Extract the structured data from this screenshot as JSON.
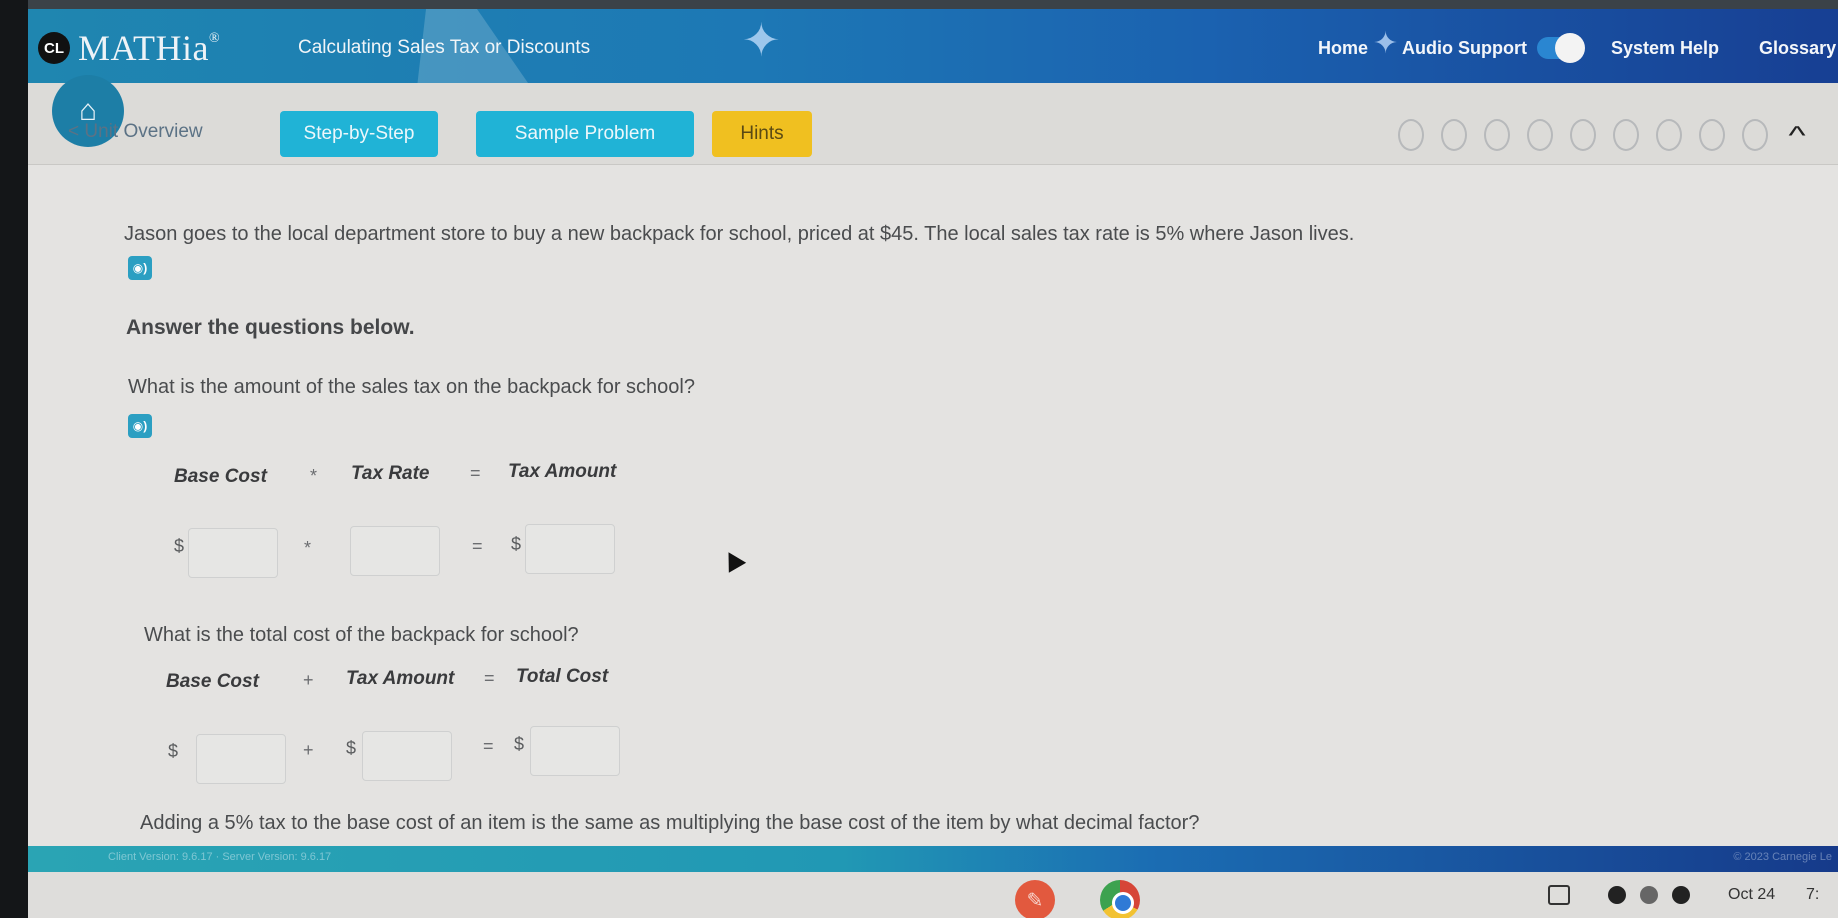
{
  "header": {
    "logo_badge": "CL",
    "logo_text": "MATHia",
    "logo_mark": "®",
    "lesson_title": "Calculating Sales Tax or Discounts",
    "nav": {
      "home": "Home",
      "audio_support": "Audio Support",
      "audio_support_enabled": true,
      "system_help": "System Help",
      "glossary": "Glossary"
    }
  },
  "toolbar": {
    "unit_overview": "< Unit Overview",
    "tabs": [
      {
        "label": "Step-by-Step",
        "color": "#20b3d6"
      },
      {
        "label": "Sample Problem",
        "color": "#20b3d6"
      },
      {
        "label": "Hints",
        "color": "#f0c020"
      }
    ],
    "progress": {
      "completed": 0,
      "total": 9
    },
    "collapse_icon": "chevron-up-icon"
  },
  "problem": {
    "intro": "Jason goes to the local department store to buy a new backpack for school, priced at $45. The local sales tax rate is 5% where Jason lives.",
    "instructions": "Answer the questions below.",
    "q1": {
      "text": "What is the amount of the sales tax on the backpack for school?",
      "labels": [
        "Base Cost",
        "Tax Rate",
        "Tax Amount"
      ],
      "operators": [
        "*",
        "="
      ],
      "prefixes": [
        "$",
        "",
        "$"
      ],
      "values": [
        "",
        "",
        ""
      ]
    },
    "q2": {
      "text": "What is the total cost of the backpack for school?",
      "labels": [
        "Base Cost",
        "Tax Amount",
        "Total Cost"
      ],
      "operators": [
        "+",
        "="
      ],
      "prefixes": [
        "$",
        "$",
        "$"
      ],
      "values": [
        "",
        "",
        ""
      ]
    },
    "q3": {
      "text": "Adding a 5% tax to the base cost of an item is the same as multiplying the base cost of the item by what decimal factor?"
    }
  },
  "footer": {
    "version_text": "Client Version: 9.6.17 · Server Version: 9.6.17",
    "copyright": "© 2023 Carnegie Le"
  },
  "shelf": {
    "date": "Oct 24",
    "time": "7:"
  }
}
